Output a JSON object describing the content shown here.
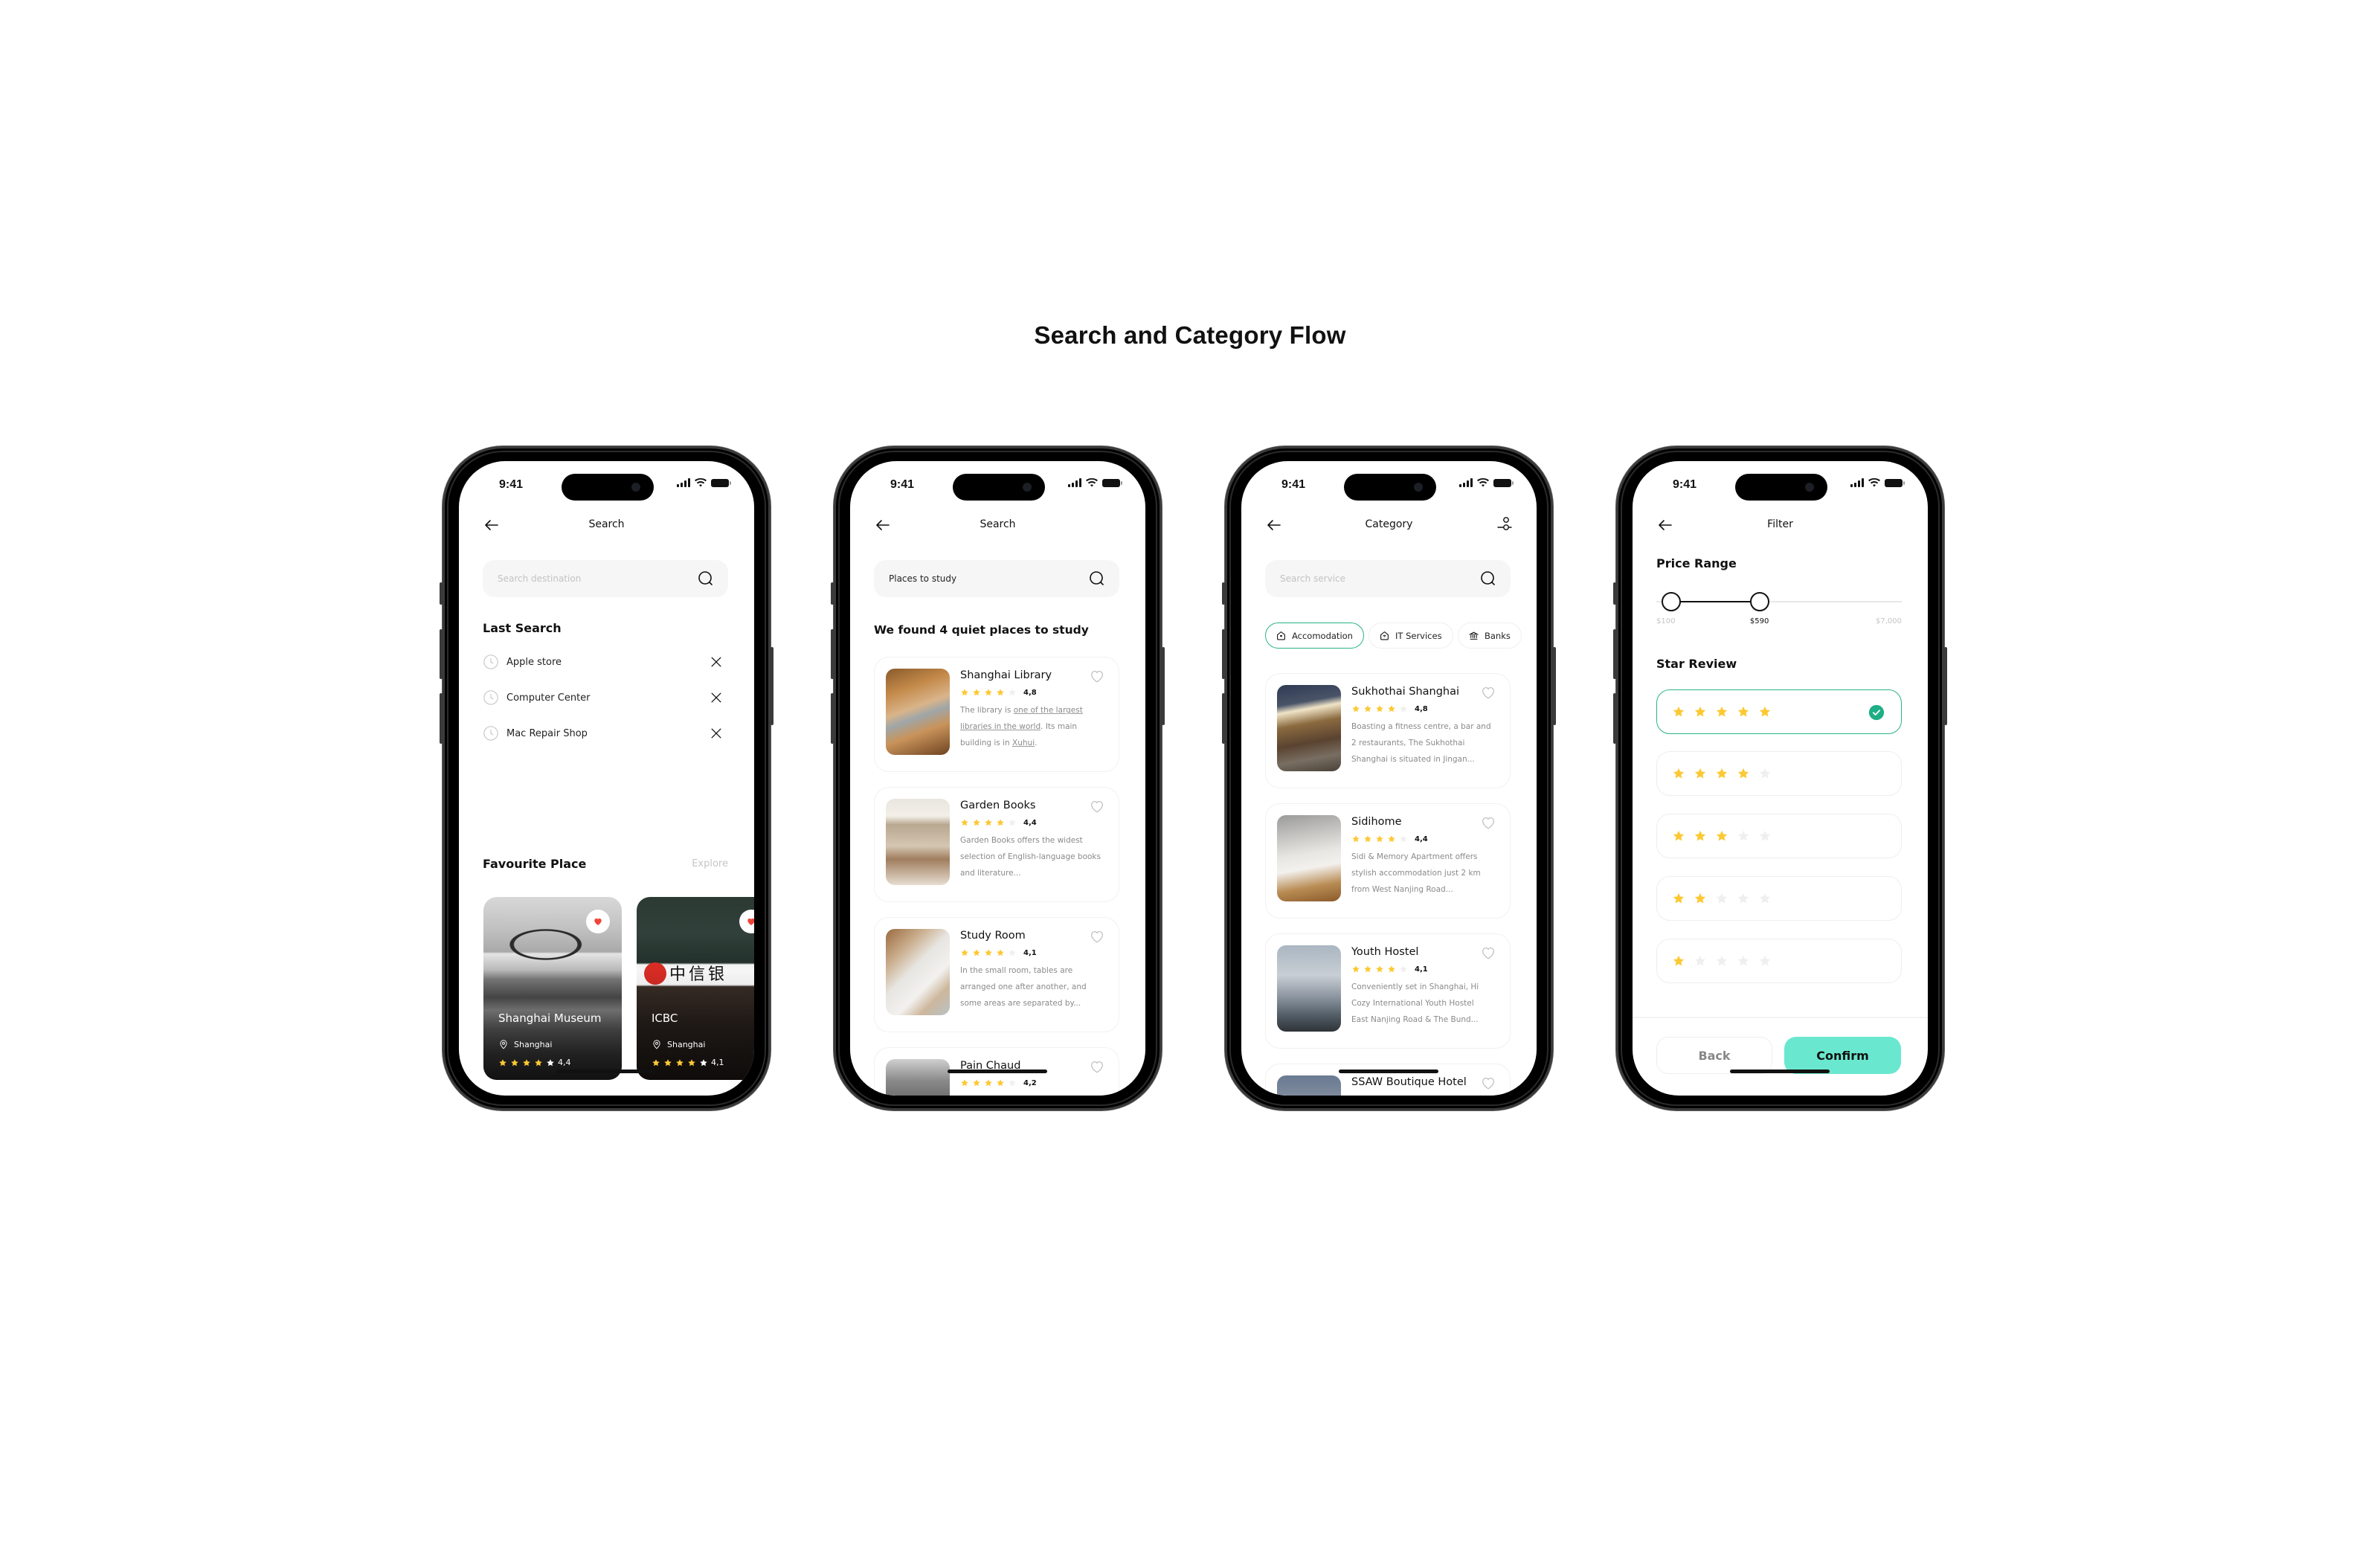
{
  "page": {
    "title": "Search and Category Flow"
  },
  "status_bar": {
    "time": "9:41"
  },
  "colors": {
    "accent_green": "#2bb38a",
    "confirm_bg": "#69e8cf",
    "star_filled": "#fcc934",
    "star_empty": "#efefef",
    "heart_red": "#f04438"
  },
  "screens": {
    "search": {
      "nav_title": "Search",
      "search_placeholder": "Search destination",
      "search_value": "",
      "last_search_heading": "Last Search",
      "recent": [
        {
          "label": "Apple store"
        },
        {
          "label": "Computer Center"
        },
        {
          "label": "Mac Repair Shop"
        }
      ],
      "favourite_heading": "Favourite Place",
      "explore_label": "Explore",
      "favourites": [
        {
          "name": "Shanghai Museum",
          "location": "Shanghai",
          "rating": "4,4",
          "stars": 4,
          "favorited": true
        },
        {
          "name": "ICBC",
          "location": "Shanghai",
          "rating": "4,1",
          "stars": 4,
          "favorited": true
        }
      ]
    },
    "results": {
      "nav_title": "Search",
      "search_value": "Places to study",
      "results_heading": "We found 4 quiet places to study",
      "items": [
        {
          "name": "Shanghai Library",
          "rating": "4,8",
          "stars": 4,
          "desc_parts": [
            "The library is ",
            "one of the largest libraries in the world",
            ". Its main building is in ",
            "Xuhui",
            "."
          ]
        },
        {
          "name": "Garden Books",
          "rating": "4,4",
          "stars": 4,
          "desc": "Garden Books offers the widest selection of English-language books and literature..."
        },
        {
          "name": "Study Room",
          "rating": "4,1",
          "stars": 4,
          "desc": "In the small room, tables are arranged one after another, and some areas are separated by..."
        },
        {
          "name": "Pain Chaud",
          "rating": "4,2",
          "stars": 4,
          "desc": ""
        }
      ]
    },
    "category": {
      "nav_title": "Category",
      "search_placeholder": "Search service",
      "chips": [
        {
          "label": "Accomodation",
          "icon": "home-icon",
          "active": true
        },
        {
          "label": "IT Services",
          "icon": "home-wifi-icon",
          "active": false
        },
        {
          "label": "Banks",
          "icon": "bank-icon",
          "active": false
        }
      ],
      "items": [
        {
          "name": "Sukhothai Shanghai",
          "rating": "4,8",
          "stars": 4,
          "desc": "Boasting a fitness centre, a bar and 2 restaurants, The Sukhothai Shanghai is situated in Jingan..."
        },
        {
          "name": "Sidihome",
          "rating": "4,4",
          "stars": 4,
          "desc": "Sidi & Memory Apartment offers stylish accommodation just 2 km from West Nanjing Road..."
        },
        {
          "name": "Youth Hostel",
          "rating": "4,1",
          "stars": 4,
          "desc": "Conveniently set in Shanghai, Hi Cozy International Youth Hostel East Nanjing Road & The Bund..."
        },
        {
          "name": "SSAW Boutique Hotel",
          "rating": "",
          "stars": 4,
          "desc": ""
        }
      ]
    },
    "filter": {
      "nav_title": "Filter",
      "price_heading": "Price Range",
      "price_min_label": "$100",
      "price_max_label": "$7,000",
      "price_current_label": "$590",
      "price_min": 100,
      "price_max": 7000,
      "range_low_fraction": 0.06,
      "range_high_fraction": 0.42,
      "star_heading": "Star Review",
      "star_options": [
        {
          "stars": 5,
          "selected": true
        },
        {
          "stars": 4,
          "selected": false
        },
        {
          "stars": 3,
          "selected": false
        },
        {
          "stars": 2,
          "selected": false
        },
        {
          "stars": 1,
          "selected": false
        }
      ],
      "back_label": "Back",
      "confirm_label": "Confirm"
    }
  }
}
